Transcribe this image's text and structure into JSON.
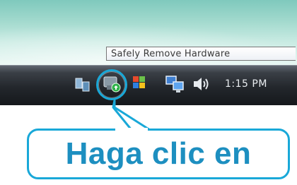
{
  "tooltip": {
    "text": "Safely Remove Hardware"
  },
  "taskbar": {
    "clock": "1:15 PM"
  },
  "tray_icons": [
    "network-icon",
    "safely-remove-hardware-icon",
    "flag-icon",
    "network-connection-icon",
    "volume-icon"
  ],
  "callout": {
    "text": "Haga clic en"
  },
  "colors": {
    "accent": "#19a8d8",
    "callout_text": "#1d8fc0",
    "taskbar": "#23272c"
  }
}
